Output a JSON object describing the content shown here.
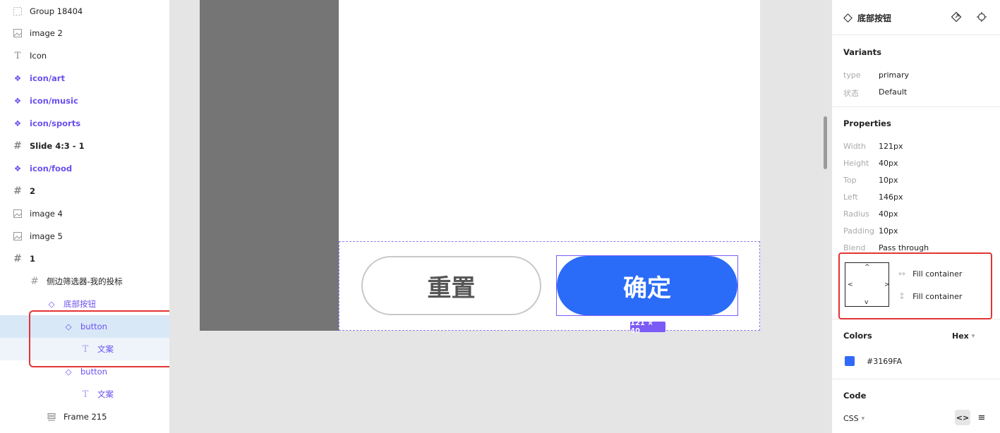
{
  "layers": [
    {
      "label": "Group 18404",
      "icon": "dashed-group-icon"
    },
    {
      "label": "image 2",
      "icon": "image-icon"
    },
    {
      "label": "Icon",
      "icon": "text-icon"
    },
    {
      "label": "icon/art",
      "icon": "component-icon"
    },
    {
      "label": "icon/music",
      "icon": "component-icon"
    },
    {
      "label": "icon/sports",
      "icon": "component-icon"
    },
    {
      "label": "Slide 4:3 - 1",
      "icon": "frame-icon"
    },
    {
      "label": "icon/food",
      "icon": "component-icon"
    },
    {
      "label": "2",
      "icon": "frame-icon"
    },
    {
      "label": "image 4",
      "icon": "image-icon"
    },
    {
      "label": "image 5",
      "icon": "image-icon"
    },
    {
      "label": "1",
      "icon": "frame-icon"
    },
    {
      "label": "侧边筛选器-我的投标",
      "icon": "frame-icon"
    },
    {
      "label": "底部按钮",
      "icon": "instance-icon"
    },
    {
      "label": "button",
      "icon": "instance-icon"
    },
    {
      "label": "文案",
      "icon": "text-icon"
    },
    {
      "label": "button",
      "icon": "instance-icon"
    },
    {
      "label": "文案",
      "icon": "text-icon"
    },
    {
      "label": "Frame 215",
      "icon": "auto-layout-icon"
    }
  ],
  "canvas": {
    "reset_label": "重置",
    "confirm_label": "确定",
    "size_badge": "121 × 40"
  },
  "inspector": {
    "component_name": "底部按钮",
    "variants_title": "Variants",
    "variants": [
      {
        "key": "type",
        "value": "primary"
      },
      {
        "key": "状态",
        "value": "Default"
      }
    ],
    "properties_title": "Properties",
    "properties": [
      {
        "key": "Width",
        "value": "121px"
      },
      {
        "key": "Height",
        "value": "40px"
      },
      {
        "key": "Top",
        "value": "10px"
      },
      {
        "key": "Left",
        "value": "146px"
      },
      {
        "key": "Radius",
        "value": "40px"
      },
      {
        "key": "Padding",
        "value": "10px"
      },
      {
        "key": "Blend",
        "value": "Pass through"
      }
    ],
    "horizontal_resizing": "Fill container",
    "vertical_resizing": "Fill container",
    "colors_title": "Colors",
    "color_format": "Hex",
    "color_value": "#3169FA",
    "code_title": "Code",
    "code_lang": "CSS"
  },
  "colors": {
    "accent_purple": "#6b4ff0",
    "primary_blue": "#3169FA",
    "highlight_red": "#e23434"
  }
}
